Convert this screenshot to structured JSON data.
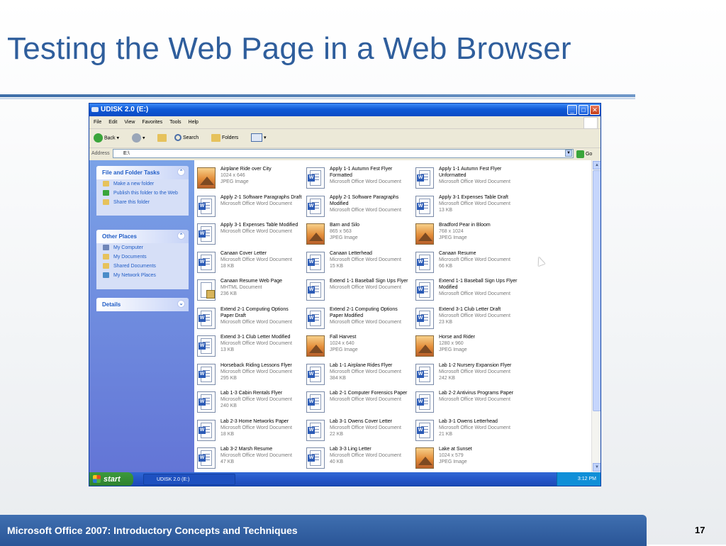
{
  "slide": {
    "title": "Testing the Web Page in a Web Browser",
    "footer": "Microsoft Office 2007: Introductory Concepts and Techniques",
    "page_number": "17"
  },
  "window": {
    "title": "UDISK 2.0 (E:)",
    "menu": [
      "File",
      "Edit",
      "View",
      "Favorites",
      "Tools",
      "Help"
    ],
    "toolbar": {
      "back": "Back",
      "search": "Search",
      "folders": "Folders"
    },
    "address": {
      "label": "Address",
      "value": "E:\\",
      "go": "Go"
    }
  },
  "left_pane": {
    "file_folder_tasks": {
      "title": "File and Folder Tasks",
      "items": [
        "Make a new folder",
        "Publish this folder to the Web",
        "Share this folder"
      ]
    },
    "other_places": {
      "title": "Other Places",
      "items": [
        "My Computer",
        "My Documents",
        "Shared Documents",
        "My Network Places"
      ]
    },
    "details": {
      "title": "Details"
    }
  },
  "files": [
    {
      "name": "Airplane Ride over City",
      "l2": "1024 x 646",
      "l3": "JPEG Image",
      "type": "jpg"
    },
    {
      "name": "Apply 1-1 Autumn Fest Flyer Formatted",
      "l2": "Microsoft Office Word Document",
      "l3": "",
      "type": "doc"
    },
    {
      "name": "Apply 1-1 Autumn Fest Flyer Unformatted",
      "l2": "Microsoft Office Word Document",
      "l3": "",
      "type": "doc"
    },
    {
      "name": "Apply 2-1 Software Paragraphs Draft",
      "l2": "Microsoft Office Word Document",
      "l3": "",
      "type": "doc"
    },
    {
      "name": "Apply 2-1 Software Paragraphs Modified",
      "l2": "Microsoft Office Word Document",
      "l3": "",
      "type": "doc"
    },
    {
      "name": "Apply 3-1 Expenses Table Draft",
      "l2": "Microsoft Office Word Document",
      "l3": "13 KB",
      "type": "doc"
    },
    {
      "name": "Apply 3-1 Expenses Table Modified",
      "l2": "Microsoft Office Word Document",
      "l3": "",
      "type": "doc"
    },
    {
      "name": "Barn and Silo",
      "l2": "865 x 563",
      "l3": "JPEG Image",
      "type": "jpg"
    },
    {
      "name": "Bradford Pear in Bloom",
      "l2": "768 x 1024",
      "l3": "JPEG Image",
      "type": "jpg"
    },
    {
      "name": "Canaan Cover Letter",
      "l2": "Microsoft Office Word Document",
      "l3": "18 KB",
      "type": "doc"
    },
    {
      "name": "Canaan Letterhead",
      "l2": "Microsoft Office Word Document",
      "l3": "15 KB",
      "type": "doc"
    },
    {
      "name": "Canaan Resume",
      "l2": "Microsoft Office Word Document",
      "l3": "66 KB",
      "type": "doc"
    },
    {
      "name": "Canaan Resume Web Page",
      "l2": "MHTML Document",
      "l3": "236 KB",
      "type": "mht"
    },
    {
      "name": "Extend 1-1 Baseball Sign Ups Flyer",
      "l2": "Microsoft Office Word Document",
      "l3": "",
      "type": "doc"
    },
    {
      "name": "Extend 1-1 Baseball Sign Ups Flyer Modified",
      "l2": "Microsoft Office Word Document",
      "l3": "",
      "type": "doc"
    },
    {
      "name": "Extend 2-1 Computing Options Paper Draft",
      "l2": "Microsoft Office Word Document",
      "l3": "",
      "type": "doc"
    },
    {
      "name": "Extend 2-1 Computing Options Paper Modified",
      "l2": "Microsoft Office Word Document",
      "l3": "",
      "type": "doc"
    },
    {
      "name": "Extend 3-1 Club Letter Draft",
      "l2": "Microsoft Office Word Document",
      "l3": "23 KB",
      "type": "doc"
    },
    {
      "name": "Extend 3-1 Club Letter Modified",
      "l2": "Microsoft Office Word Document",
      "l3": "13 KB",
      "type": "doc"
    },
    {
      "name": "Fall Harvest",
      "l2": "1024 x 640",
      "l3": "JPEG Image",
      "type": "jpg"
    },
    {
      "name": "Horse and Rider",
      "l2": "1280 x 960",
      "l3": "JPEG Image",
      "type": "jpg"
    },
    {
      "name": "Horseback Riding Lessons Flyer",
      "l2": "Microsoft Office Word Document",
      "l3": "295 KB",
      "type": "doc"
    },
    {
      "name": "Lab 1-1 Airplane Rides Flyer",
      "l2": "Microsoft Office Word Document",
      "l3": "384 KB",
      "type": "doc"
    },
    {
      "name": "Lab 1-2 Nursery Expansion Flyer",
      "l2": "Microsoft Office Word Document",
      "l3": "242 KB",
      "type": "doc"
    },
    {
      "name": "Lab 1-3 Cabin Rentals Flyer",
      "l2": "Microsoft Office Word Document",
      "l3": "240 KB",
      "type": "doc"
    },
    {
      "name": "Lab 2-1 Computer Forensics Paper",
      "l2": "Microsoft Office Word Document",
      "l3": "",
      "type": "doc"
    },
    {
      "name": "Lab 2-2 Antivirus Programs Paper",
      "l2": "Microsoft Office Word Document",
      "l3": "",
      "type": "doc"
    },
    {
      "name": "Lab 2-3 Home Networks Paper",
      "l2": "Microsoft Office Word Document",
      "l3": "18 KB",
      "type": "doc"
    },
    {
      "name": "Lab 3-1 Owens Cover Letter",
      "l2": "Microsoft Office Word Document",
      "l3": "22 KB",
      "type": "doc"
    },
    {
      "name": "Lab 3-1 Owens Letterhead",
      "l2": "Microsoft Office Word Document",
      "l3": "21 KB",
      "type": "doc"
    },
    {
      "name": "Lab 3-2 Marsh Resume",
      "l2": "Microsoft Office Word Document",
      "l3": "47 KB",
      "type": "doc"
    },
    {
      "name": "Lab 3-3 Ling Letter",
      "l2": "Microsoft Office Word Document",
      "l3": "40 KB",
      "type": "doc"
    },
    {
      "name": "Lake at Sunset",
      "l2": "1024 x 579",
      "l3": "JPEG Image",
      "type": "jpg"
    }
  ],
  "taskbar": {
    "start": "start",
    "task": "UDISK 2.0 (E:)",
    "clock": "3:12 PM"
  },
  "colors": {
    "title_blue": "#2f5e9c",
    "xp_title_bar": "#0a4bc4",
    "pane_blue": "#6375d6",
    "link_blue": "#215dc6",
    "start_green": "#3c9a3c"
  }
}
